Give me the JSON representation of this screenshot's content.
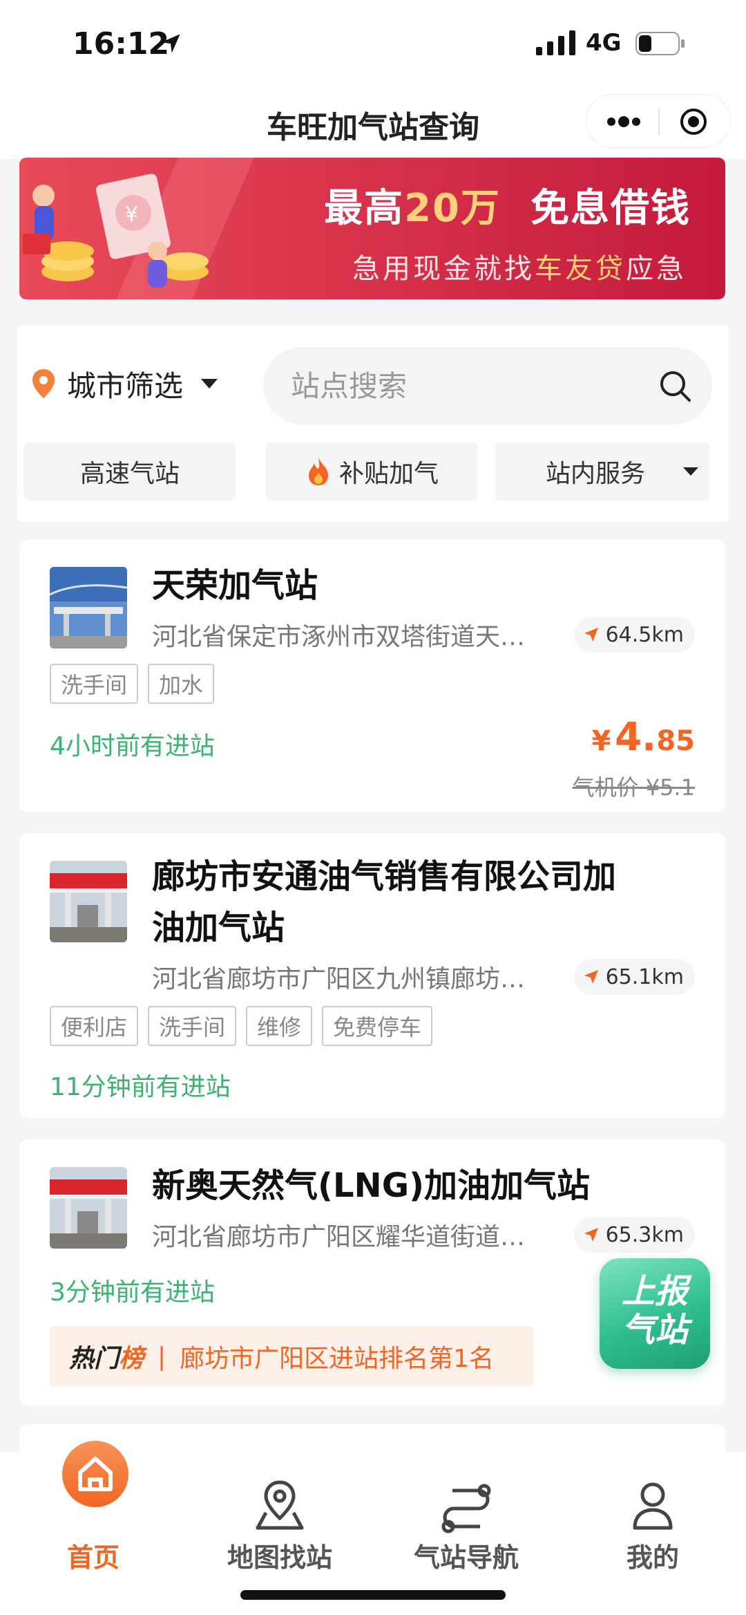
{
  "status_bar": {
    "time": "16:12",
    "network": "4G"
  },
  "nav": {
    "title": "车旺加气站查询"
  },
  "banner": {
    "line1_pre": "最高",
    "line1_amount": "20万",
    "line1_post": "免息借钱",
    "line2_pre": "急用现金就找",
    "line2_brand": "车友贷",
    "line2_post": "应急"
  },
  "filters": {
    "city_label": "城市筛选",
    "search_placeholder": "站点搜索",
    "chips": [
      "高速气站",
      "补贴加气",
      "站内服务"
    ]
  },
  "stations": [
    {
      "name": "天荣加气站",
      "address": "河北省保定市涿州市双塔街道天…",
      "distance": "64.5km",
      "tags": [
        "洗手间",
        "加水"
      ],
      "recent": "4小时前有进站",
      "price_currency": "¥",
      "price_int": "4.",
      "price_dec": "85",
      "orig_price": "气机价 ¥5.1"
    },
    {
      "name_line1": "廊坊市安通油气销售有限公司加",
      "name_line2": "油加气站",
      "address": "河北省廊坊市广阳区九州镇廊坊…",
      "distance": "65.1km",
      "tags": [
        "便利店",
        "洗手间",
        "维修",
        "免费停车"
      ],
      "recent": "11分钟前有进站"
    },
    {
      "name": "新奥天然气(LNG)加油加气站",
      "address": "河北省廊坊市广阳区耀华道街道…",
      "distance": "65.3km",
      "recent": "3分钟前有进站",
      "hot_label_a": "热门",
      "hot_label_b": "榜",
      "hot_divider": "|",
      "hot_text": "廊坊市广阳区进站排名第1名"
    }
  ],
  "report_button": {
    "line1": "上报",
    "line2": "气站"
  },
  "tabs": [
    {
      "label": "首页",
      "icon": "home-icon",
      "active": true
    },
    {
      "label": "地图找站",
      "icon": "map-pin-icon"
    },
    {
      "label": "气站导航",
      "icon": "route-icon"
    },
    {
      "label": "我的",
      "icon": "user-icon"
    }
  ],
  "colors": {
    "accent": "#f26522",
    "green": "#3cb371",
    "banner_red": "#d8344c"
  }
}
